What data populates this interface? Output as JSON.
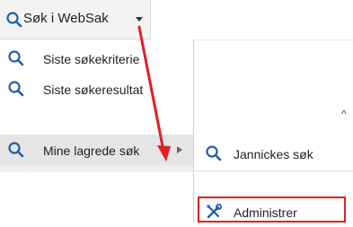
{
  "toolbar": {
    "search_label": "Søk i WebSak",
    "search_icon": "search-icon",
    "dropdown_icon": "caret-down-icon"
  },
  "menu": {
    "items": [
      {
        "label": "Siste søkekriterie",
        "icon": "search-icon"
      },
      {
        "label": "Siste søkeresultat",
        "icon": "search-icon"
      },
      {
        "label": "Mine lagrede søk",
        "icon": "search-icon",
        "has_submenu": true,
        "highlighted": true
      }
    ]
  },
  "submenu": {
    "items": [
      {
        "label": "Jannickes søk",
        "icon": "search-icon"
      },
      {
        "label": "Administrer",
        "icon": "wrench-screwdriver-icon",
        "highlighted_box": true
      }
    ]
  },
  "colors": {
    "accent_blue": "#1e5fa8",
    "annotation_red": "#e02020",
    "menu_highlight": "#e5e5e5"
  }
}
